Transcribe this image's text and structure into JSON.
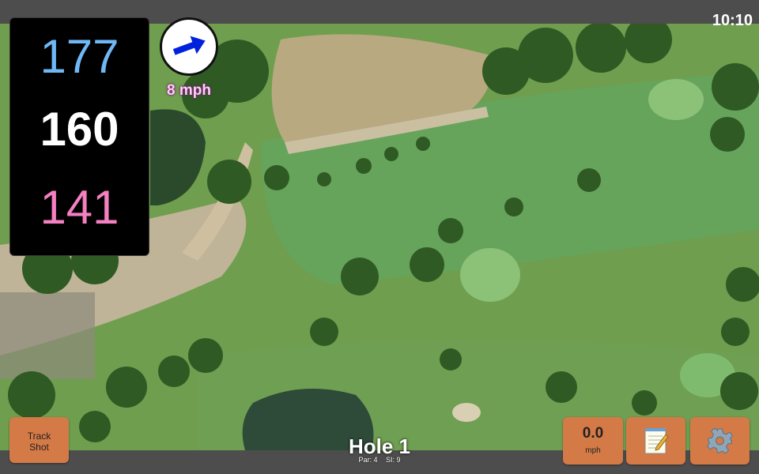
{
  "status": {
    "time": "10:10"
  },
  "distances": {
    "back": "177",
    "center": "160",
    "front": "141"
  },
  "wind": {
    "speed": "8 mph",
    "direction_icon": "arrow-icon",
    "circle_color": "#ffffff",
    "arrow_color": "#0022dd"
  },
  "hole": {
    "title": "Hole 1",
    "par": "Par: 4",
    "si": "SI: 9"
  },
  "buttons": {
    "track_shot": {
      "line1": "Track",
      "line2": "Shot"
    },
    "speed": {
      "value": "0.0",
      "unit": "mph"
    },
    "notes_icon": "notepad-icon",
    "settings_icon": "gear-icon"
  },
  "colors": {
    "back": "#6fb8f5",
    "center": "#ffffff",
    "front": "#f47fc1",
    "button": "#d47a46",
    "bar": "#4d4d4d"
  }
}
